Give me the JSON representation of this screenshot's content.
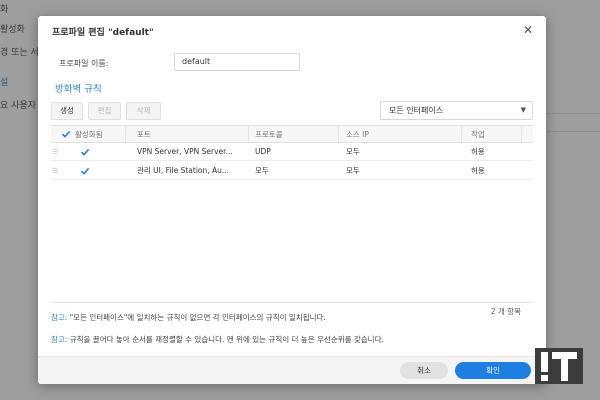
{
  "background": {
    "items": [
      "화",
      "활성화",
      "경 또는 서비",
      "설",
      "요 사용자 지"
    ]
  },
  "dialog": {
    "title": "프로파일 편집 \"default\"",
    "close_icon": "close-icon",
    "profile_name_label": "프로파일 이름:",
    "profile_name_value": "default",
    "section_title": "방화벽 규칙",
    "toolbar": {
      "create_label": "생성",
      "edit_label": "편집",
      "delete_label": "삭제"
    },
    "interface_select": {
      "value": "모든 인터페이스",
      "caret_icon": "caret-down-icon"
    },
    "table": {
      "columns": [
        "활성화됨",
        "포트",
        "프로토콜",
        "소스 IP",
        "작업"
      ],
      "rows": [
        {
          "enabled": true,
          "port": "VPN Server, VPN Server...",
          "protocol": "UDP",
          "source_ip": "모두",
          "action": "허용"
        },
        {
          "enabled": true,
          "port": "관리 UI, File Station, Au...",
          "protocol": "모두",
          "source_ip": "모두",
          "action": "허용"
        }
      ],
      "item_count": "2 개 항목"
    },
    "notes": [
      {
        "label": "참고:",
        "text": "\"모든 인터페이스\"에 일치하는 규칙이 없으면 각 인터페이스의 규칙이 일치됩니다."
      },
      {
        "label": "참고:",
        "text": "규칙을 끌어다 놓아 순서를 재정렬할 수 있습니다. 맨 위에 있는 규칙이 더 높은 우선순위를 갖습니다."
      }
    ],
    "buttons": {
      "cancel_label": "취소",
      "ok_label": "확인"
    }
  },
  "colors": {
    "accent": "#1f7ee2",
    "section_title": "#2f86d6",
    "check": "#1f7ee2"
  },
  "watermark": {
    "text": "IT"
  }
}
